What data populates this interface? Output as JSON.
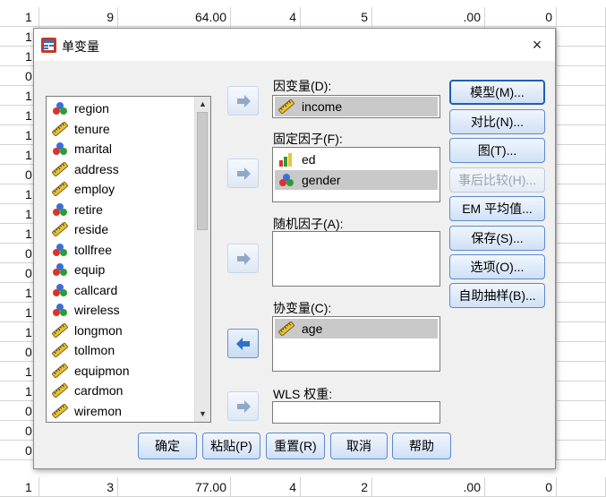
{
  "spreadsheet": {
    "rows": [
      {
        "rownum": "1",
        "c1": "9",
        "c2": "64.00",
        "c3": "4",
        "c4": "5",
        "c5": ".00",
        "c6": "0"
      },
      {
        "rownum": "1",
        "c1": "",
        "c2": "",
        "c3": "",
        "c4": "",
        "c5": "",
        "c6": ""
      },
      {
        "rownum": "1",
        "c1": "",
        "c2": "",
        "c3": "",
        "c4": "",
        "c5": "",
        "c6": ""
      },
      {
        "rownum": "0",
        "c1": "",
        "c2": "",
        "c3": "",
        "c4": "",
        "c5": "",
        "c6": ""
      },
      {
        "rownum": "1",
        "c1": "",
        "c2": "",
        "c3": "",
        "c4": "",
        "c5": "",
        "c6": ""
      },
      {
        "rownum": "1",
        "c1": "",
        "c2": "",
        "c3": "",
        "c4": "",
        "c5": "",
        "c6": ""
      },
      {
        "rownum": "1",
        "c1": "",
        "c2": "",
        "c3": "",
        "c4": "",
        "c5": "",
        "c6": ""
      },
      {
        "rownum": "1",
        "c1": "",
        "c2": "",
        "c3": "",
        "c4": "",
        "c5": "",
        "c6": ""
      },
      {
        "rownum": "0",
        "c1": "",
        "c2": "",
        "c3": "",
        "c4": "",
        "c5": "",
        "c6": ""
      },
      {
        "rownum": "1",
        "c1": "",
        "c2": "",
        "c3": "",
        "c4": "",
        "c5": "",
        "c6": ""
      },
      {
        "rownum": "1",
        "c1": "",
        "c2": "",
        "c3": "",
        "c4": "",
        "c5": "",
        "c6": ""
      },
      {
        "rownum": "1",
        "c1": "",
        "c2": "",
        "c3": "",
        "c4": "",
        "c5": "",
        "c6": ""
      },
      {
        "rownum": "0",
        "c1": "",
        "c2": "",
        "c3": "",
        "c4": "",
        "c5": "",
        "c6": ""
      },
      {
        "rownum": "0",
        "c1": "",
        "c2": "",
        "c3": "",
        "c4": "",
        "c5": "",
        "c6": ""
      },
      {
        "rownum": "1",
        "c1": "",
        "c2": "",
        "c3": "",
        "c4": "",
        "c5": "",
        "c6": ""
      },
      {
        "rownum": "1",
        "c1": "",
        "c2": "",
        "c3": "",
        "c4": "",
        "c5": "",
        "c6": ""
      },
      {
        "rownum": "1",
        "c1": "",
        "c2": "",
        "c3": "",
        "c4": "",
        "c5": "",
        "c6": ""
      },
      {
        "rownum": "0",
        "c1": "",
        "c2": "",
        "c3": "",
        "c4": "",
        "c5": "",
        "c6": ""
      },
      {
        "rownum": "1",
        "c1": "",
        "c2": "",
        "c3": "",
        "c4": "",
        "c5": "",
        "c6": ""
      },
      {
        "rownum": "1",
        "c1": "",
        "c2": "",
        "c3": "",
        "c4": "",
        "c5": "",
        "c6": ""
      },
      {
        "rownum": "0",
        "c1": "",
        "c2": "",
        "c3": "",
        "c4": "",
        "c5": "",
        "c6": ""
      },
      {
        "rownum": "0",
        "c1": "",
        "c2": "",
        "c3": "",
        "c4": "",
        "c5": "",
        "c6": ""
      },
      {
        "rownum": "0",
        "c1": "",
        "c2": "",
        "c3": "",
        "c4": "",
        "c5": "",
        "c6": ""
      },
      {
        "rownum": "1",
        "c1": "3",
        "c2": "77.00",
        "c3": "4",
        "c4": "2",
        "c5": ".00",
        "c6": "0"
      }
    ]
  },
  "dialog": {
    "title": "单变量",
    "close": "×",
    "variables": [
      {
        "name": "region",
        "icon": "nominal-icon"
      },
      {
        "name": "tenure",
        "icon": "scale-icon"
      },
      {
        "name": "marital",
        "icon": "nominal-icon"
      },
      {
        "name": "address",
        "icon": "scale-icon"
      },
      {
        "name": "employ",
        "icon": "scale-icon"
      },
      {
        "name": "retire",
        "icon": "nominal-icon"
      },
      {
        "name": "reside",
        "icon": "scale-icon"
      },
      {
        "name": "tollfree",
        "icon": "nominal-icon"
      },
      {
        "name": "equip",
        "icon": "nominal-icon"
      },
      {
        "name": "callcard",
        "icon": "nominal-icon"
      },
      {
        "name": "wireless",
        "icon": "nominal-icon"
      },
      {
        "name": "longmon",
        "icon": "scale-icon"
      },
      {
        "name": "tollmon",
        "icon": "scale-icon"
      },
      {
        "name": "equipmon",
        "icon": "scale-icon"
      },
      {
        "name": "cardmon",
        "icon": "scale-icon"
      },
      {
        "name": "wiremon",
        "icon": "scale-icon"
      }
    ],
    "dependent": {
      "label": "因变量(D):",
      "value": "income"
    },
    "fixed": {
      "label": "固定因子(F):",
      "items": [
        "ed",
        "gender"
      ]
    },
    "random": {
      "label": "随机因子(A):"
    },
    "covariate": {
      "label": "协变量(C):",
      "items": [
        "age"
      ]
    },
    "wls": {
      "label": "WLS 权重:",
      "value": ""
    },
    "right_buttons": {
      "model": "模型(M)...",
      "contrast": "对比(N)...",
      "plots": "图(T)...",
      "posthoc": "事后比较(H)...",
      "em_means": "EM 平均值...",
      "save": "保存(S)...",
      "options": "选项(O)...",
      "bootstrap": "自助抽样(B)..."
    },
    "bottom_buttons": {
      "ok": "确定",
      "paste": "粘贴(P)",
      "reset": "重置(R)",
      "cancel": "取消",
      "help": "帮助"
    },
    "colors": {
      "accent": "#1d5fb8",
      "selection": "#c9c9c9"
    }
  }
}
